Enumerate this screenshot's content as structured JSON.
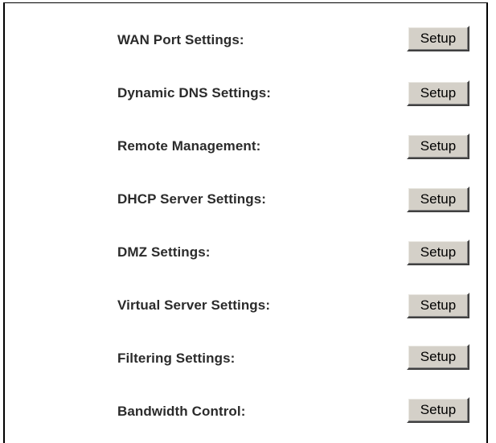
{
  "settings": [
    {
      "label": "WAN Port Settings:",
      "button": "Setup"
    },
    {
      "label": "Dynamic DNS Settings:",
      "button": "Setup"
    },
    {
      "label": "Remote Management:",
      "button": "Setup"
    },
    {
      "label": "DHCP Server Settings:",
      "button": "Setup"
    },
    {
      "label": "DMZ Settings:",
      "button": "Setup"
    },
    {
      "label": "Virtual Server Settings:",
      "button": "Setup"
    },
    {
      "label": "Filtering Settings:",
      "button": "Setup"
    },
    {
      "label": "Bandwidth Control:",
      "button": "Setup"
    }
  ],
  "colors": {
    "button_face": "#d4d0c8",
    "label_text": "#2b2b2b",
    "border": "#000000"
  }
}
